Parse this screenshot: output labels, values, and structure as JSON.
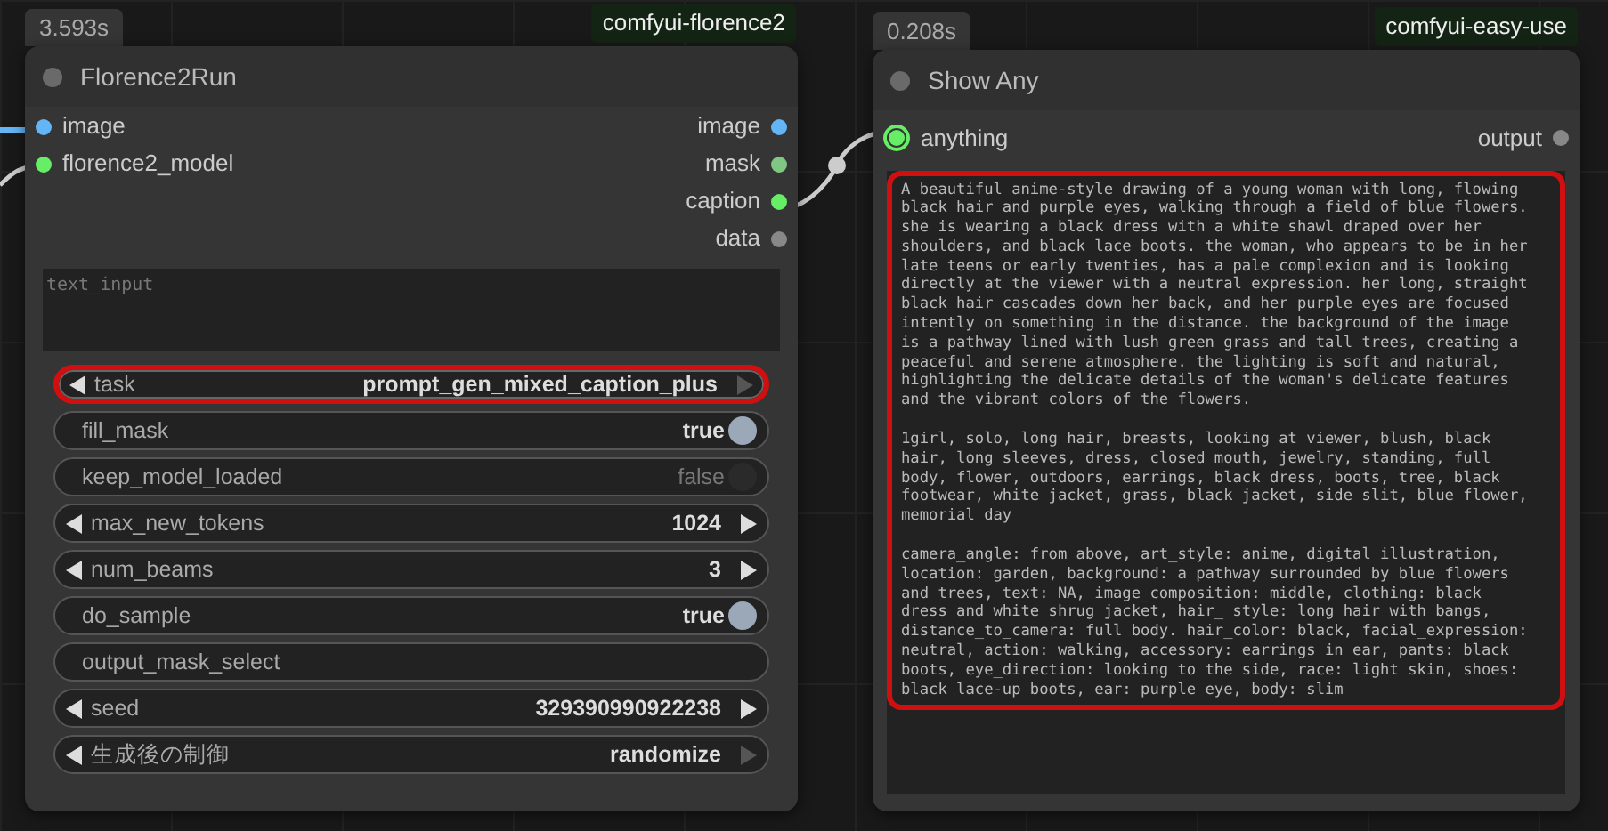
{
  "nodes": [
    {
      "time": "3.593s",
      "package": "comfyui-florence2",
      "title": "Florence2Run",
      "inputs": [
        {
          "name": "image",
          "color": "#64b5f6"
        },
        {
          "name": "florence2_model",
          "color": "#66ee66"
        }
      ],
      "outputs": [
        {
          "name": "image",
          "color": "#64b5f6"
        },
        {
          "name": "mask",
          "color": "#81c784"
        },
        {
          "name": "caption",
          "color": "#66ee66"
        },
        {
          "name": "data",
          "color": "#888888"
        }
      ],
      "text_input": {
        "placeholder": "text_input"
      },
      "widgets": [
        {
          "kind": "combo",
          "label": "task",
          "value": "prompt_gen_mixed_caption_plus",
          "highlighted": true
        },
        {
          "kind": "toggle",
          "label": "fill_mask",
          "value": "true",
          "on": true,
          "highlighted": false
        },
        {
          "kind": "toggle",
          "label": "keep_model_loaded",
          "value": "false",
          "on": false,
          "highlighted": false
        },
        {
          "kind": "number",
          "label": "max_new_tokens",
          "value": "1024",
          "highlighted": false
        },
        {
          "kind": "number",
          "label": "num_beams",
          "value": "3",
          "highlighted": false
        },
        {
          "kind": "toggle",
          "label": "do_sample",
          "value": "true",
          "on": true,
          "highlighted": false
        },
        {
          "kind": "text",
          "label": "output_mask_select",
          "highlighted": false
        },
        {
          "kind": "number",
          "label": "seed",
          "value": "329390990922238",
          "highlighted": false
        },
        {
          "kind": "combo",
          "label": "生成後の制御",
          "value": "randomize",
          "highlighted": false
        }
      ]
    },
    {
      "time": "0.208s",
      "package": "comfyui-easy-use",
      "title": "Show Any",
      "inputs": [
        {
          "name": "anything",
          "color": "#66ee66"
        }
      ],
      "outputs": [
        {
          "name": "output",
          "color": "#888888"
        }
      ],
      "output_text": {
        "highlighted": true,
        "paragraphs": [
          "A beautiful anime-style drawing of a young woman with long, flowing\nblack hair and purple eyes, walking through a field of blue flowers.\nshe is wearing a black dress with a white shawl draped over her\nshoulders, and black lace boots. the woman, who appears to be in her\nlate teens or early twenties, has a pale complexion and is looking\ndirectly at the viewer with a neutral expression. her long, straight\nblack hair cascades down her back, and her purple eyes are focused\nintently on something in the distance. the background of the image\nis a pathway lined with lush green grass and tall trees, creating a\npeaceful and serene atmosphere. the lighting is soft and natural,\nhighlighting the delicate details of the woman's delicate features\nand the vibrant colors of the flowers.",
          "1girl, solo, long hair, breasts, looking at viewer, blush, black\nhair, long sleeves, dress, closed mouth, jewelry, standing, full\nbody, flower, outdoors, earrings, black dress, boots, tree, black\nfootwear, white jacket, grass, black jacket, side slit, blue flower,\nmemorial day",
          "camera_angle: from above, art_style: anime, digital illustration,\nlocation: garden, background: a pathway surrounded by blue flowers\nand trees, text: NA, image_composition: middle, clothing: black\ndress and white shrug jacket, hair_ style: long hair with bangs,\ndistance_to_camera: full body. hair_color: black, facial_expression:\nneutral, action: walking, accessory: earrings in ear, pants: black\nboots, eye_direction: looking to the side, race: light skin, shoes:\nblack lace-up boots, ear: purple eye, body: slim"
        ]
      }
    }
  ]
}
